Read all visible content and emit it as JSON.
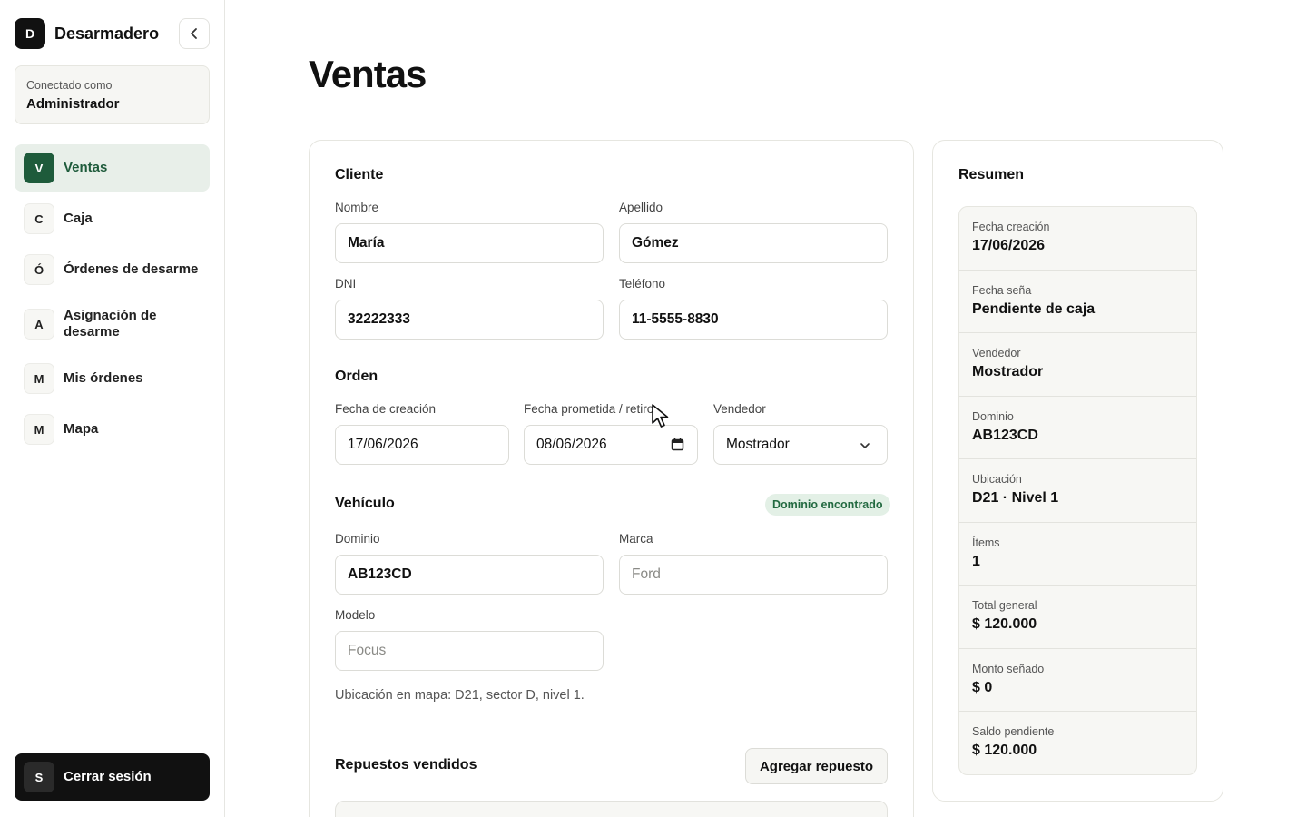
{
  "app": {
    "brand_initial": "D",
    "brand_name": "Desarmadero",
    "user_caption": "Conectado como",
    "user_role": "Administrador"
  },
  "nav": [
    {
      "badge": "V",
      "label": "Ventas",
      "active": true
    },
    {
      "badge": "C",
      "label": "Caja"
    },
    {
      "badge": "Ó",
      "label": "Órdenes de desarme"
    },
    {
      "badge": "A",
      "label": "Asignación de desarme"
    },
    {
      "badge": "M",
      "label": "Mis órdenes"
    },
    {
      "badge": "M",
      "label": "Mapa"
    }
  ],
  "logout": {
    "badge": "S",
    "label": "Cerrar sesión"
  },
  "page": {
    "title": "Ventas"
  },
  "cliente": {
    "title": "Cliente",
    "nombre_label": "Nombre",
    "nombre": "María",
    "apellido_label": "Apellido",
    "apellido": "Gómez",
    "dni_label": "DNI",
    "dni": "32222333",
    "telefono_label": "Teléfono",
    "telefono": "11-5555-8830"
  },
  "orden": {
    "title": "Orden",
    "fecha_creacion_label": "Fecha de creación",
    "fecha_creacion": "17/06/2026",
    "fecha_prometida_label": "Fecha prometida / retiro",
    "fecha_prometida": "08/06/2026",
    "vendedor_label": "Vendedor",
    "vendedor": "Mostrador"
  },
  "vehiculo": {
    "title": "Vehículo",
    "status_badge": "Dominio encontrado",
    "dominio_label": "Dominio",
    "dominio": "AB123CD",
    "marca_label": "Marca",
    "marca_placeholder": "Ford",
    "modelo_label": "Modelo",
    "modelo_placeholder": "Focus",
    "map_note": "Ubicación en mapa: D21, sector D, nivel 1."
  },
  "repuestos": {
    "title": "Repuestos vendidos",
    "add_button": "Agregar repuesto"
  },
  "resumen": {
    "title": "Resumen",
    "rows": [
      {
        "label": "Fecha creación",
        "value": "17/06/2026"
      },
      {
        "label": "Fecha seña",
        "value": "Pendiente de caja"
      },
      {
        "label": "Vendedor",
        "value": "Mostrador"
      },
      {
        "label": "Dominio",
        "value": "AB123CD"
      },
      {
        "label": "Ubicación",
        "value": "D21 · Nivel 1"
      },
      {
        "label": "Ítems",
        "value": "1"
      },
      {
        "label": "Total general",
        "value": "$ 120.000"
      },
      {
        "label": "Monto señado",
        "value": "$ 0"
      },
      {
        "label": "Saldo pendiente",
        "value": "$ 120.000"
      }
    ]
  },
  "colors": {
    "accent": "#1e5b3b",
    "active_bg": "#e8efe9",
    "badge_bg": "#e3f0e6"
  },
  "icons": {
    "collapse": "chevron-left-icon",
    "calendar": "calendar-icon",
    "select": "chevron-down-icon"
  }
}
